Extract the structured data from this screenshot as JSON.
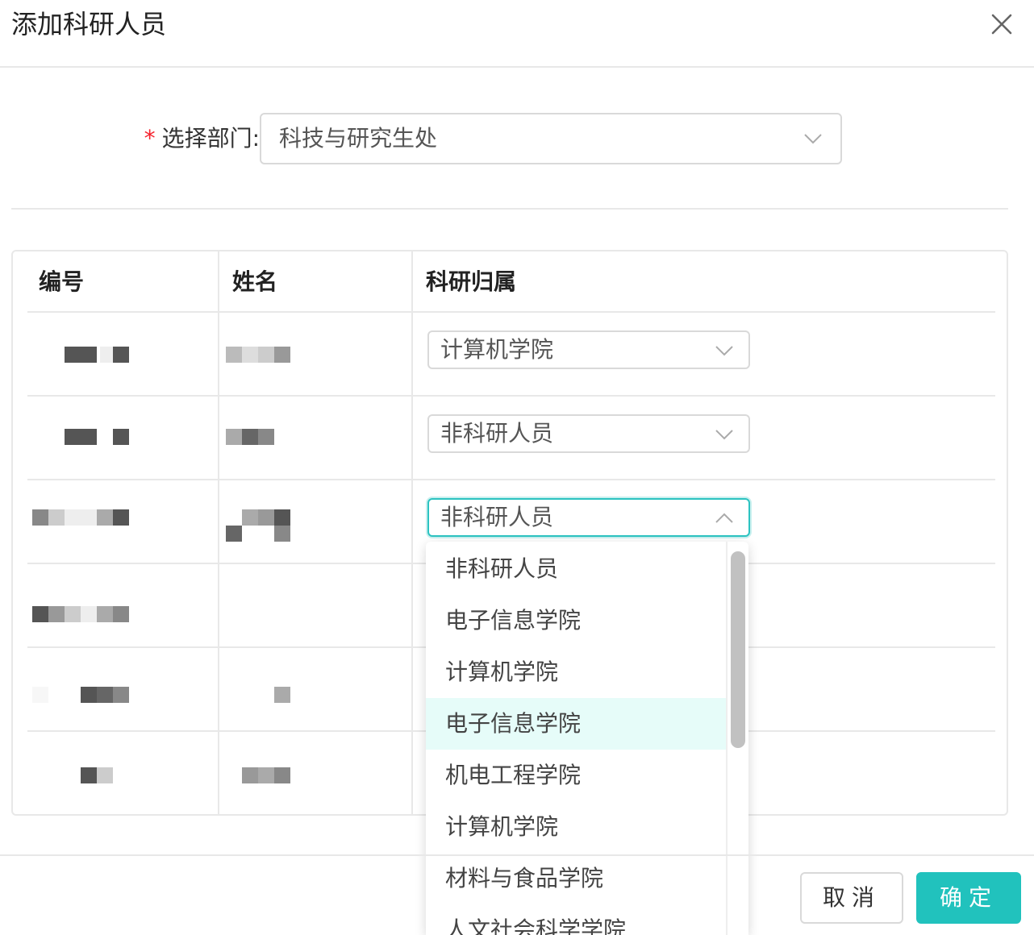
{
  "dialog": {
    "title": "添加科研人员"
  },
  "form": {
    "dept_label": "选择部门:",
    "required_mark": "*",
    "dept_value": "科技与研究生处"
  },
  "table": {
    "headers": [
      "编号",
      "姓名",
      "科研归属"
    ],
    "rows": [
      {
        "affiliation": "计算机学院"
      },
      {
        "affiliation": "非科研人员"
      },
      {
        "affiliation": "非科研人员",
        "open": true
      }
    ]
  },
  "dropdown": {
    "options": [
      "非科研人员",
      "电子信息学院",
      "计算机学院",
      "电子信息学院",
      "机电工程学院",
      "计算机学院",
      "材料与食品学院",
      "人文社会科学学院"
    ],
    "highlighted_index": 3
  },
  "footer": {
    "cancel_label": "取消",
    "ok_label": "确定"
  },
  "colors": {
    "accent": "#21c2bd",
    "highlight": "#e6fcf9",
    "required": "#f5222d"
  },
  "icons": {
    "close": "close-icon",
    "select_arrow": "chevron-down-icon",
    "select_arrow_open": "chevron-up-icon"
  }
}
